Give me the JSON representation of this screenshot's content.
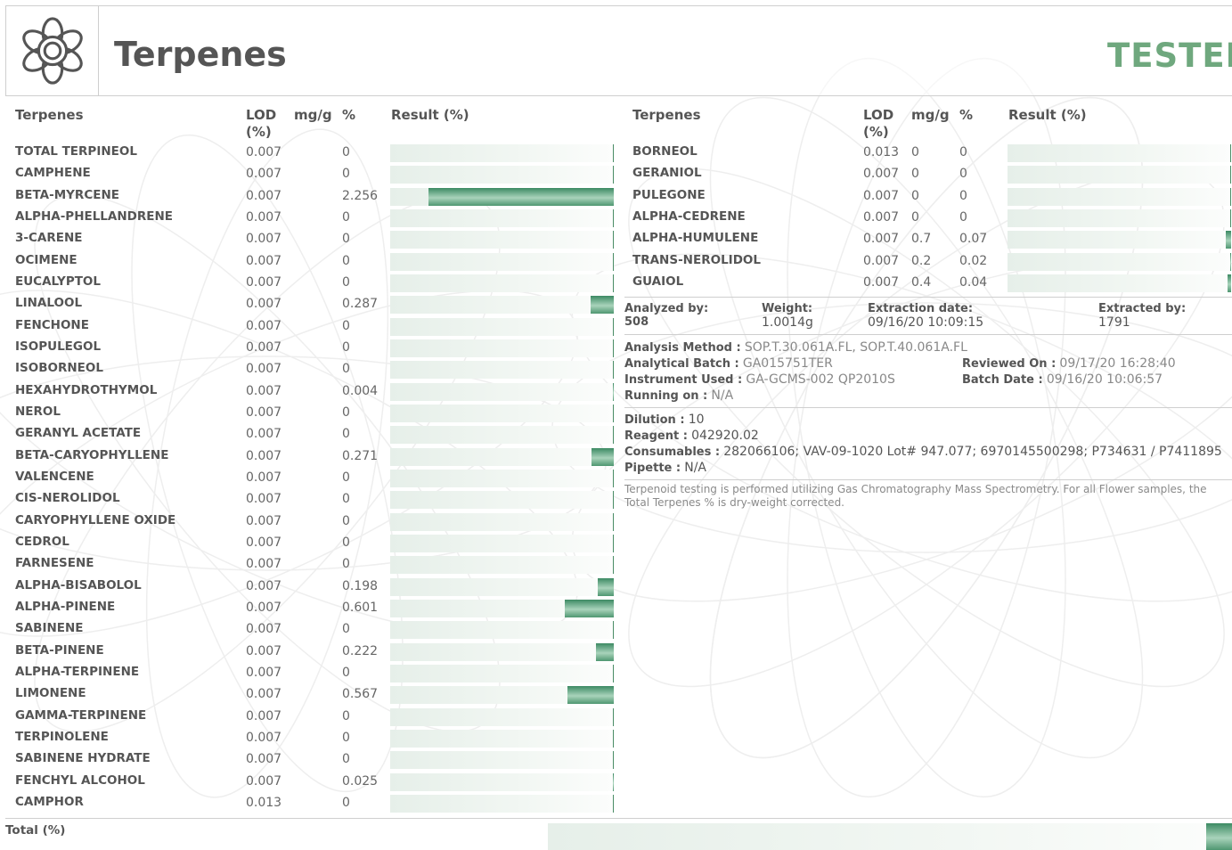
{
  "header": {
    "title": "Terpenes",
    "status": "TESTED",
    "logo_icon": "flower-icon"
  },
  "columns": {
    "name": "Terpenes",
    "lod": "LOD (%)",
    "mg": "mg/g",
    "pct": "%",
    "result": "Result (%)"
  },
  "left_rows": [
    {
      "name": "TOTAL TERPINEOL",
      "lod": "0.007",
      "mg": "",
      "pct": "0",
      "level": 0
    },
    {
      "name": "CAMPHENE",
      "lod": "0.007",
      "mg": "",
      "pct": "0",
      "level": 0
    },
    {
      "name": "BETA-MYRCENE",
      "lod": "0.007",
      "mg": "",
      "pct": "2.256",
      "level": 2.256
    },
    {
      "name": "ALPHA-PHELLANDRENE",
      "lod": "0.007",
      "mg": "",
      "pct": "0",
      "level": 0
    },
    {
      "name": "3-CARENE",
      "lod": "0.007",
      "mg": "",
      "pct": "0",
      "level": 0
    },
    {
      "name": "OCIMENE",
      "lod": "0.007",
      "mg": "",
      "pct": "0",
      "level": 0
    },
    {
      "name": "EUCALYPTOL",
      "lod": "0.007",
      "mg": "",
      "pct": "0",
      "level": 0
    },
    {
      "name": "LINALOOL",
      "lod": "0.007",
      "mg": "",
      "pct": "0.287",
      "level": 0.287
    },
    {
      "name": "FENCHONE",
      "lod": "0.007",
      "mg": "",
      "pct": "0",
      "level": 0
    },
    {
      "name": "ISOPULEGOL",
      "lod": "0.007",
      "mg": "",
      "pct": "0",
      "level": 0
    },
    {
      "name": "ISOBORNEOL",
      "lod": "0.007",
      "mg": "",
      "pct": "0",
      "level": 0
    },
    {
      "name": "HEXAHYDROTHYMOL",
      "lod": "0.007",
      "mg": "",
      "pct": "0.004",
      "level": 0.004
    },
    {
      "name": "NEROL",
      "lod": "0.007",
      "mg": "",
      "pct": "0",
      "level": 0
    },
    {
      "name": "GERANYL ACETATE",
      "lod": "0.007",
      "mg": "",
      "pct": "0",
      "level": 0
    },
    {
      "name": "BETA-CARYOPHYLLENE",
      "lod": "0.007",
      "mg": "",
      "pct": "0.271",
      "level": 0.271
    },
    {
      "name": "VALENCENE",
      "lod": "0.007",
      "mg": "",
      "pct": "0",
      "level": 0
    },
    {
      "name": "CIS-NEROLIDOL",
      "lod": "0.007",
      "mg": "",
      "pct": "0",
      "level": 0
    },
    {
      "name": "CARYOPHYLLENE OXIDE",
      "lod": "0.007",
      "mg": "",
      "pct": "0",
      "level": 0
    },
    {
      "name": "CEDROL",
      "lod": "0.007",
      "mg": "",
      "pct": "0",
      "level": 0
    },
    {
      "name": "FARNESENE",
      "lod": "0.007",
      "mg": "",
      "pct": "0",
      "level": 0
    },
    {
      "name": "ALPHA-BISABOLOL",
      "lod": "0.007",
      "mg": "",
      "pct": "0.198",
      "level": 0.198
    },
    {
      "name": "ALPHA-PINENE",
      "lod": "0.007",
      "mg": "",
      "pct": "0.601",
      "level": 0.601
    },
    {
      "name": "SABINENE",
      "lod": "0.007",
      "mg": "",
      "pct": "0",
      "level": 0
    },
    {
      "name": "BETA-PINENE",
      "lod": "0.007",
      "mg": "",
      "pct": "0.222",
      "level": 0.222
    },
    {
      "name": "ALPHA-TERPINENE",
      "lod": "0.007",
      "mg": "",
      "pct": "0",
      "level": 0
    },
    {
      "name": "LIMONENE",
      "lod": "0.007",
      "mg": "",
      "pct": "0.567",
      "level": 0.567
    },
    {
      "name": "GAMMA-TERPINENE",
      "lod": "0.007",
      "mg": "",
      "pct": "0",
      "level": 0
    },
    {
      "name": "TERPINOLENE",
      "lod": "0.007",
      "mg": "",
      "pct": "0",
      "level": 0
    },
    {
      "name": "SABINENE HYDRATE",
      "lod": "0.007",
      "mg": "",
      "pct": "0",
      "level": 0
    },
    {
      "name": "FENCHYL ALCOHOL",
      "lod": "0.007",
      "mg": "",
      "pct": "0.025",
      "level": 0.025
    },
    {
      "name": "CAMPHOR",
      "lod": "0.013",
      "mg": "",
      "pct": "0",
      "level": 0
    }
  ],
  "right_rows": [
    {
      "name": "BORNEOL",
      "lod": "0.013",
      "mg": "0",
      "pct": "0",
      "level": 0
    },
    {
      "name": "GERANIOL",
      "lod": "0.007",
      "mg": "0",
      "pct": "0",
      "level": 0
    },
    {
      "name": "PULEGONE",
      "lod": "0.007",
      "mg": "0",
      "pct": "0",
      "level": 0
    },
    {
      "name": "ALPHA-CEDRENE",
      "lod": "0.007",
      "mg": "0",
      "pct": "0",
      "level": 0
    },
    {
      "name": "ALPHA-HUMULENE",
      "lod": "0.007",
      "mg": "0.7",
      "pct": "0.07",
      "level": 0.07
    },
    {
      "name": "TRANS-NEROLIDOL",
      "lod": "0.007",
      "mg": "0.2",
      "pct": "0.02",
      "level": 0.02
    },
    {
      "name": "GUAIOL",
      "lod": "0.007",
      "mg": "0.4",
      "pct": "0.04",
      "level": 0.04
    }
  ],
  "analysis": {
    "analyzed_by_label": "Analyzed by:",
    "analyzed_by": "508",
    "weight_label": "Weight:",
    "weight": "1.0014g",
    "extraction_date_label": "Extraction date:",
    "extraction_date": "09/16/20 10:09:15",
    "extracted_by_label": "Extracted by:",
    "extracted_by": "1791",
    "method_label": "Analysis Method :",
    "method": "SOP.T.30.061A.FL, SOP.T.40.061A.FL",
    "batch_label": "Analytical Batch :",
    "batch": "GA015751TER",
    "reviewed_label": "Reviewed On :",
    "reviewed": "09/17/20 16:28:40",
    "instrument_label": "Instrument Used :",
    "instrument": "GA-GCMS-002 QP2010S",
    "batch_date_label": "Batch Date :",
    "batch_date": "09/16/20 10:06:57",
    "running_label": "Running on :",
    "running": "N/A",
    "dilution_label": "Dilution :",
    "dilution": "10",
    "reagent_label": "Reagent :",
    "reagent": "042920.02",
    "consumables_label": "Consumables :",
    "consumables": "282066106; VAV-09-1020 Lot# 947.077; 6970145500298; P734631 / P7411895",
    "pipette_label": "Pipette :",
    "pipette": "N/A",
    "note": "Terpenoid testing is performed utilizing Gas Chromatography Mass Spectrometry. For all Flower samples, the Total Terpenes % is dry-weight corrected."
  },
  "total": {
    "label": "Total (%)"
  },
  "colors": {
    "accent_green": "#6fa87e",
    "bar_green": "#3c8a63",
    "text": "#555555",
    "muted": "#888888"
  }
}
